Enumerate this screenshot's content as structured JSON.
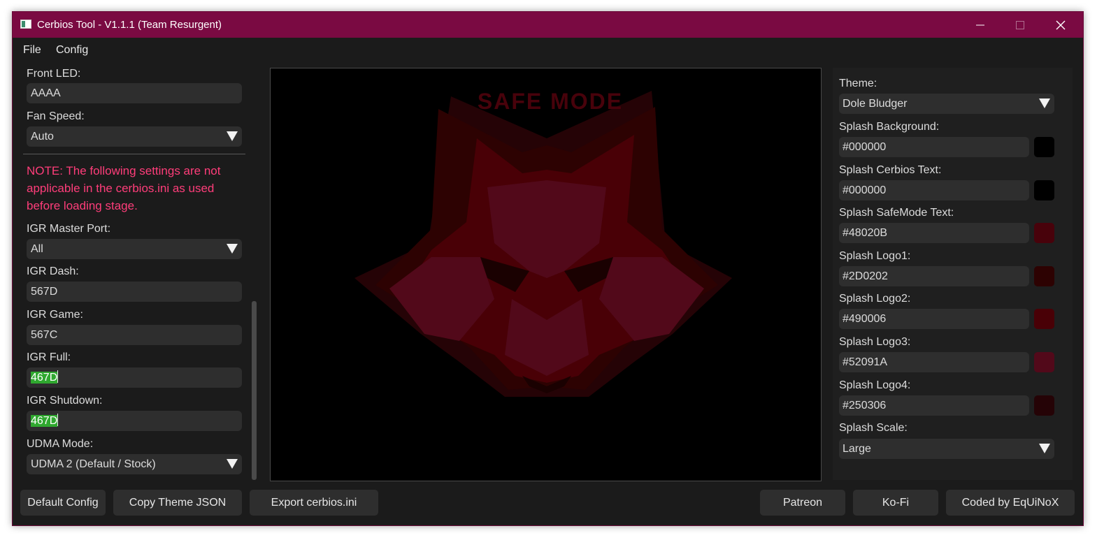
{
  "window": {
    "title": "Cerbios Tool - V1.1.1 (Team Resurgent)"
  },
  "menu": [
    "File",
    "Config"
  ],
  "left": {
    "front_led": {
      "label": "Front LED:",
      "value": "AAAA"
    },
    "fan_speed": {
      "label": "Fan Speed:",
      "value": "Auto"
    },
    "note": "NOTE: The following settings are not applicable in the cerbios.ini as used before loading stage.",
    "igr_master_port": {
      "label": "IGR Master Port:",
      "value": "All"
    },
    "igr_dash": {
      "label": "IGR Dash:",
      "value": "567D"
    },
    "igr_game": {
      "label": "IGR Game:",
      "value": "567C"
    },
    "igr_full": {
      "label": "IGR Full:",
      "value": "467D"
    },
    "igr_shutdown": {
      "label": "IGR Shutdown:",
      "value": "467D"
    },
    "udma_mode": {
      "label": "UDMA Mode:",
      "value": "UDMA 2 (Default / Stock)"
    }
  },
  "preview": {
    "safe_mode_text": "SAFE MODE",
    "colors": {
      "safemode_text": "#48020B",
      "logo1": "#2D0202",
      "logo2": "#490006",
      "logo3": "#52091A",
      "logo4": "#250306"
    }
  },
  "right": {
    "theme": {
      "label": "Theme:",
      "value": "Dole Bludger"
    },
    "splash_background": {
      "label": "Splash Background:",
      "value": "#000000",
      "swatch": "#000000"
    },
    "splash_cerbios_text": {
      "label": "Splash Cerbios Text:",
      "value": "#000000",
      "swatch": "#000000"
    },
    "splash_safemode_text": {
      "label": "Splash SafeMode Text:",
      "value": "#48020B",
      "swatch": "#48020B"
    },
    "splash_logo1": {
      "label": "Splash Logo1:",
      "value": "#2D0202",
      "swatch": "#2D0202"
    },
    "splash_logo2": {
      "label": "Splash Logo2:",
      "value": "#490006",
      "swatch": "#490006"
    },
    "splash_logo3": {
      "label": "Splash Logo3:",
      "value": "#52091A",
      "swatch": "#52091A"
    },
    "splash_logo4": {
      "label": "Splash Logo4:",
      "value": "#250306",
      "swatch": "#250306"
    },
    "splash_scale": {
      "label": "Splash Scale:",
      "value": "Large"
    }
  },
  "buttons": {
    "default_config": "Default Config",
    "copy_theme_json": "Copy Theme JSON",
    "export_ini": "Export cerbios.ini",
    "patreon": "Patreon",
    "kofi": "Ko-Fi",
    "coded_by": "Coded by EqUiNoX"
  }
}
